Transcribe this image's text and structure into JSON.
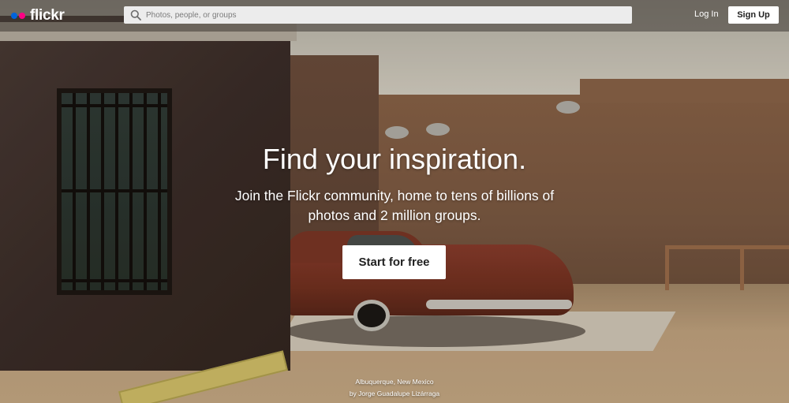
{
  "header": {
    "brand": "flickr",
    "brand_colors": {
      "blue": "#0063dc",
      "pink": "#ff0084"
    },
    "search": {
      "placeholder": "Photos, people, or groups",
      "value": "",
      "icon": "search-icon"
    },
    "login_label": "Log In",
    "signup_label": "Sign Up"
  },
  "hero": {
    "title": "Find your inspiration.",
    "subtitle": "Join the Flickr community, home to tens of billions of photos and 2 million groups.",
    "cta_label": "Start for free"
  },
  "photo_credit": {
    "location": "Albuquerque, New Mexico",
    "author": "by Jorge Guadalupe Lizárraga"
  }
}
